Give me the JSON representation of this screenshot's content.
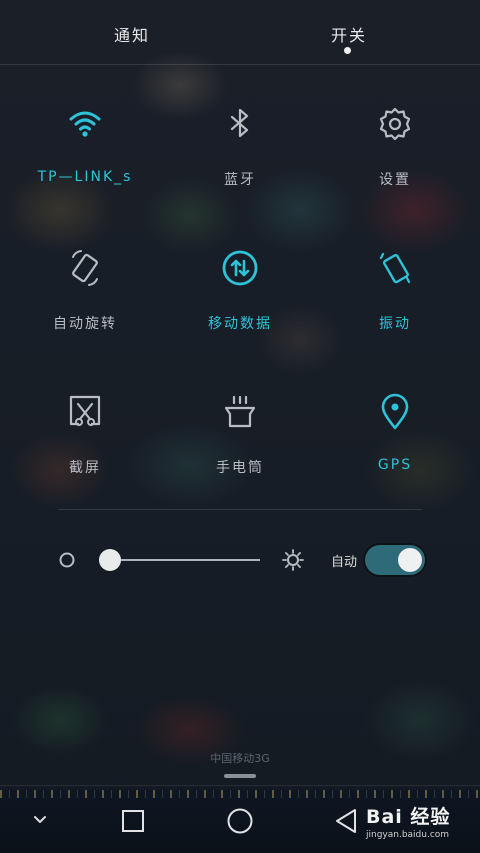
{
  "tabs": {
    "notifications": "通知",
    "switches": "开关"
  },
  "tiles": [
    {
      "label": "TP—LINK_s",
      "icon": "wifi-icon",
      "state": "on"
    },
    {
      "label": "蓝牙",
      "icon": "bluetooth-icon",
      "state": "off"
    },
    {
      "label": "设置",
      "icon": "gear-icon",
      "state": "off"
    },
    {
      "label": "自动旋转",
      "icon": "auto-rotate-icon",
      "state": "off"
    },
    {
      "label": "移动数据",
      "icon": "mobile-data-icon",
      "state": "on"
    },
    {
      "label": "振动",
      "icon": "vibrate-icon",
      "state": "on"
    },
    {
      "label": "截屏",
      "icon": "screenshot-icon",
      "state": "off"
    },
    {
      "label": "手电筒",
      "icon": "flashlight-icon",
      "state": "off"
    },
    {
      "label": "GPS",
      "icon": "location-pin-icon",
      "state": "on"
    }
  ],
  "brightness": {
    "level": 0.0,
    "auto_label": "自动",
    "auto_enabled": true
  },
  "carrier": "中国移动3G",
  "watermark": {
    "brand": "Bai 经验",
    "url": "jingyan.baidu.com"
  },
  "colors": {
    "accent": "#2ec3d8",
    "inactive": "#b8bcc3",
    "toggle_on": "#2e6b78"
  }
}
